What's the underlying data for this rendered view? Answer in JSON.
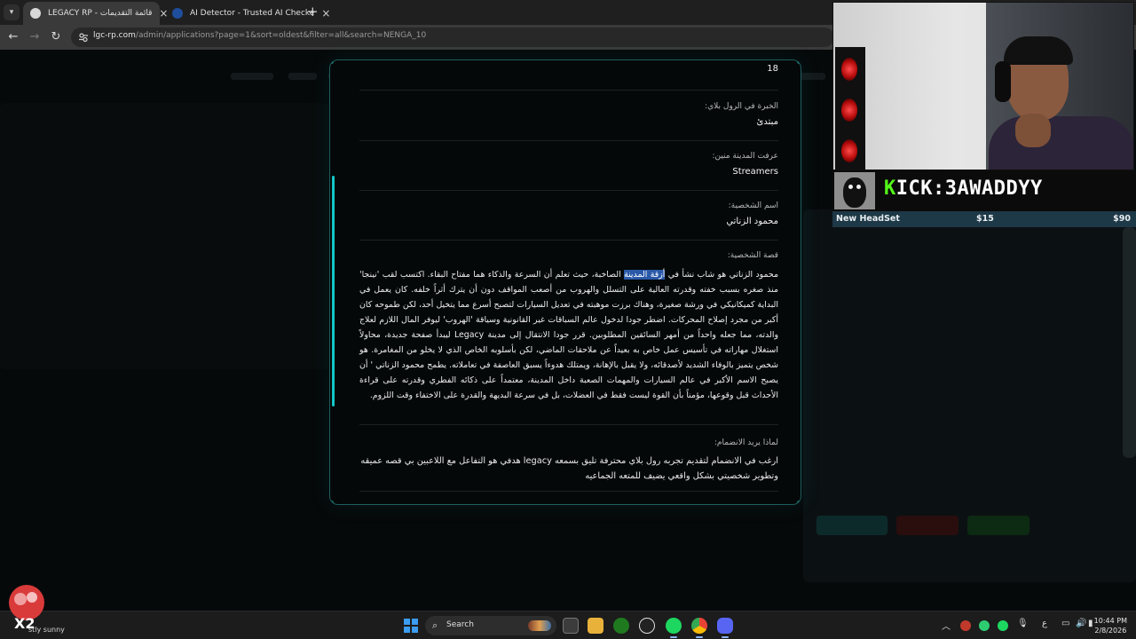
{
  "browser": {
    "tabs": [
      {
        "title": "LEGACY RP - قائمة التقديمات",
        "active": true
      },
      {
        "title": "AI Detector - Trusted AI Checke",
        "active": false
      }
    ],
    "new_tab": "+",
    "url_host": "lgc-rp.com",
    "url_path": "/admin/applications?page=1&sort=oldest&filter=all&search=NENGA_10"
  },
  "application": {
    "age_value": "18",
    "experience_label": "الخبرة في الرول بلاي:",
    "experience_value": "مبتدئ",
    "source_label": "عرفت المدينة منين:",
    "source_value": "Streamers",
    "name_label": "اسم الشخصية:",
    "name_value": "محمود الزناتي",
    "story_label": "قصة الشخصية:",
    "story_before": "محمود الزناتي هو شاب نشأ في ",
    "story_highlight": "أزقة المدينة",
    "story_after": " الصاخبة، حيث تعلم أن السرعة والذكاء هما مفتاح البقاء. اكتسب لقب 'نينجا' منذ صغره بسبب خفته وقدرته العالية على التسلل والهروب من أصعب المواقف دون أن يترك أثراً خلفه. كان يعمل في البداية كميكانيكي في ورشة صغيرة، وهناك برزت موهبته في تعديل السيارات لتصبح أسرع مما يتخيل أحد، لكن طموحه كان أكبر من مجرد إصلاح المحركات. اضطر جودا لدخول عالم السباقات غير القانونية وسياقة 'الهروب' ليوفر المال اللازم لعلاج والدته، مما جعله واحداً من أمهر السائقين المطلوبين. قرر جودا الانتقال إلى مدينة Legacy ليبدأ صفحة جديدة، محاولاً استغلال مهاراته في تأسيس عمل خاص به بعيداً عن ملاحقات الماضي، لكن بأسلوبه الخاص الذي لا يخلو من المغامرة. هو شخص يتميز بالوفاء الشديد لأصدقائه، ولا يقبل بالإهانة، ويمتلك هدوءاً يسبق العاصفة في تعاملاته. يطمح محمود الزناتي ' أن يصبح الاسم الأكبر في عالم السيارات والمهمات الصعبة داخل المدينة، معتمداً على ذكائه الفطري وقدرته على قراءة الأحداث قبل وقوعها، مؤمناً بأن القوة ليست فقط في العضلات، بل في سرعة البديهة والقدرة على الاختفاء وقت اللزوم.",
    "why_label": "لماذا يريد الانضمام:",
    "why_value": "ارغب في الانضمام لتقديم تجربه رول بلاي محترفة تليق بسمعه legacy هدفي هو التفاعل مع اللاعبين بي قصه عميقه وتطوير شخصيتي بشكل واقعي يضيف للمتعه الجماعيه"
  },
  "stream": {
    "channel": "KICK:3AWADDYY",
    "channel_prefix": "K",
    "channel_rest": "ICK:3AWADDYY",
    "goal_label": "New HeadSet",
    "goal_current": "$15",
    "goal_target": "$90"
  },
  "taskbar": {
    "weather_text": "stly sunny",
    "weather_badge": "X2",
    "search_label": "Search",
    "lang": "ع",
    "time": "10:44 PM",
    "date": "2/8/2026"
  },
  "colors": {
    "accent_teal": "#13c6c6",
    "kick_green": "#53fc18",
    "highlight": "#2a59a8"
  }
}
